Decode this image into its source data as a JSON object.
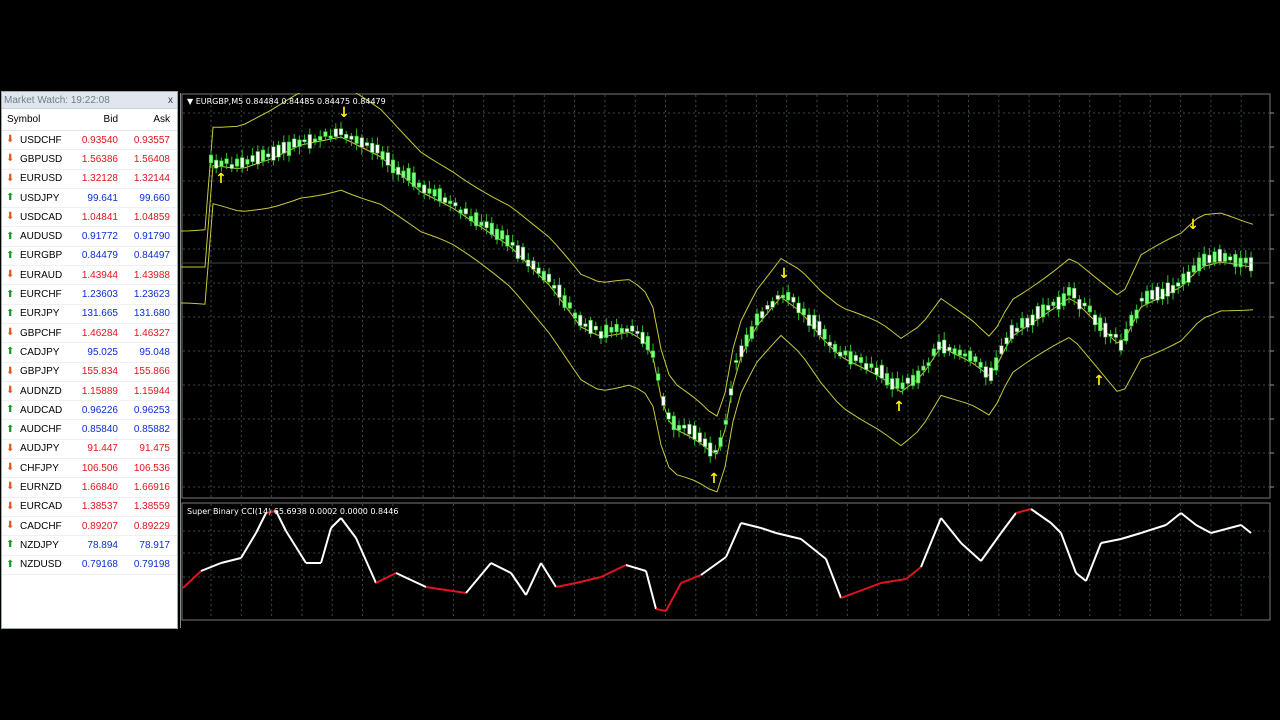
{
  "market_watch": {
    "title": "Market Watch: 19:22:08",
    "close_label": "x",
    "headers": [
      "Symbol",
      "Bid",
      "Ask"
    ],
    "rows": [
      {
        "symbol": "USDCHF",
        "bid": "0.93540",
        "ask": "0.93557",
        "dir": "dn"
      },
      {
        "symbol": "GBPUSD",
        "bid": "1.56386",
        "ask": "1.56408",
        "dir": "dn"
      },
      {
        "symbol": "EURUSD",
        "bid": "1.32128",
        "ask": "1.32144",
        "dir": "dn"
      },
      {
        "symbol": "USDJPY",
        "bid": "99.641",
        "ask": "99.660",
        "dir": "up"
      },
      {
        "symbol": "USDCAD",
        "bid": "1.04841",
        "ask": "1.04859",
        "dir": "dn"
      },
      {
        "symbol": "AUDUSD",
        "bid": "0.91772",
        "ask": "0.91790",
        "dir": "up"
      },
      {
        "symbol": "EURGBP",
        "bid": "0.84479",
        "ask": "0.84497",
        "dir": "up"
      },
      {
        "symbol": "EURAUD",
        "bid": "1.43944",
        "ask": "1.43988",
        "dir": "dn"
      },
      {
        "symbol": "EURCHF",
        "bid": "1.23603",
        "ask": "1.23623",
        "dir": "up"
      },
      {
        "symbol": "EURJPY",
        "bid": "131.665",
        "ask": "131.680",
        "dir": "up"
      },
      {
        "symbol": "GBPCHF",
        "bid": "1.46284",
        "ask": "1.46327",
        "dir": "dn"
      },
      {
        "symbol": "CADJPY",
        "bid": "95.025",
        "ask": "95.048",
        "dir": "up"
      },
      {
        "symbol": "GBPJPY",
        "bid": "155.834",
        "ask": "155.866",
        "dir": "dn"
      },
      {
        "symbol": "AUDNZD",
        "bid": "1.15889",
        "ask": "1.15944",
        "dir": "dn"
      },
      {
        "symbol": "AUDCAD",
        "bid": "0.96226",
        "ask": "0.96253",
        "dir": "up"
      },
      {
        "symbol": "AUDCHF",
        "bid": "0.85840",
        "ask": "0.85882",
        "dir": "up"
      },
      {
        "symbol": "AUDJPY",
        "bid": "91.447",
        "ask": "91.475",
        "dir": "dn"
      },
      {
        "symbol": "CHFJPY",
        "bid": "106.506",
        "ask": "106.536",
        "dir": "dn"
      },
      {
        "symbol": "EURNZD",
        "bid": "1.66840",
        "ask": "1.66916",
        "dir": "dn"
      },
      {
        "symbol": "EURCAD",
        "bid": "1.38537",
        "ask": "1.38559",
        "dir": "dn"
      },
      {
        "symbol": "CADCHF",
        "bid": "0.89207",
        "ask": "0.89229",
        "dir": "dn"
      },
      {
        "symbol": "NZDJPY",
        "bid": "78.894",
        "ask": "78.917",
        "dir": "up"
      },
      {
        "symbol": "NZDUSD",
        "bid": "0.79168",
        "ask": "0.79198",
        "dir": "up"
      }
    ]
  },
  "chart": {
    "header": "EURGBP,M5  0.84484 0.84485 0.84475 0.84479",
    "indicator_header": "Super Binary CCI(14) 65.6938 0.0002 0.0000 0.8446",
    "colors": {
      "bull_candle": "#7cff7c",
      "bear_candle": "#ffffff",
      "wick": "#2fbf2f",
      "band": "#c8c83a",
      "arrow": "#ffee00",
      "cci_up": "#ffffff",
      "cci_down": "#e0141c",
      "grid": "#3a4a4a"
    }
  }
}
